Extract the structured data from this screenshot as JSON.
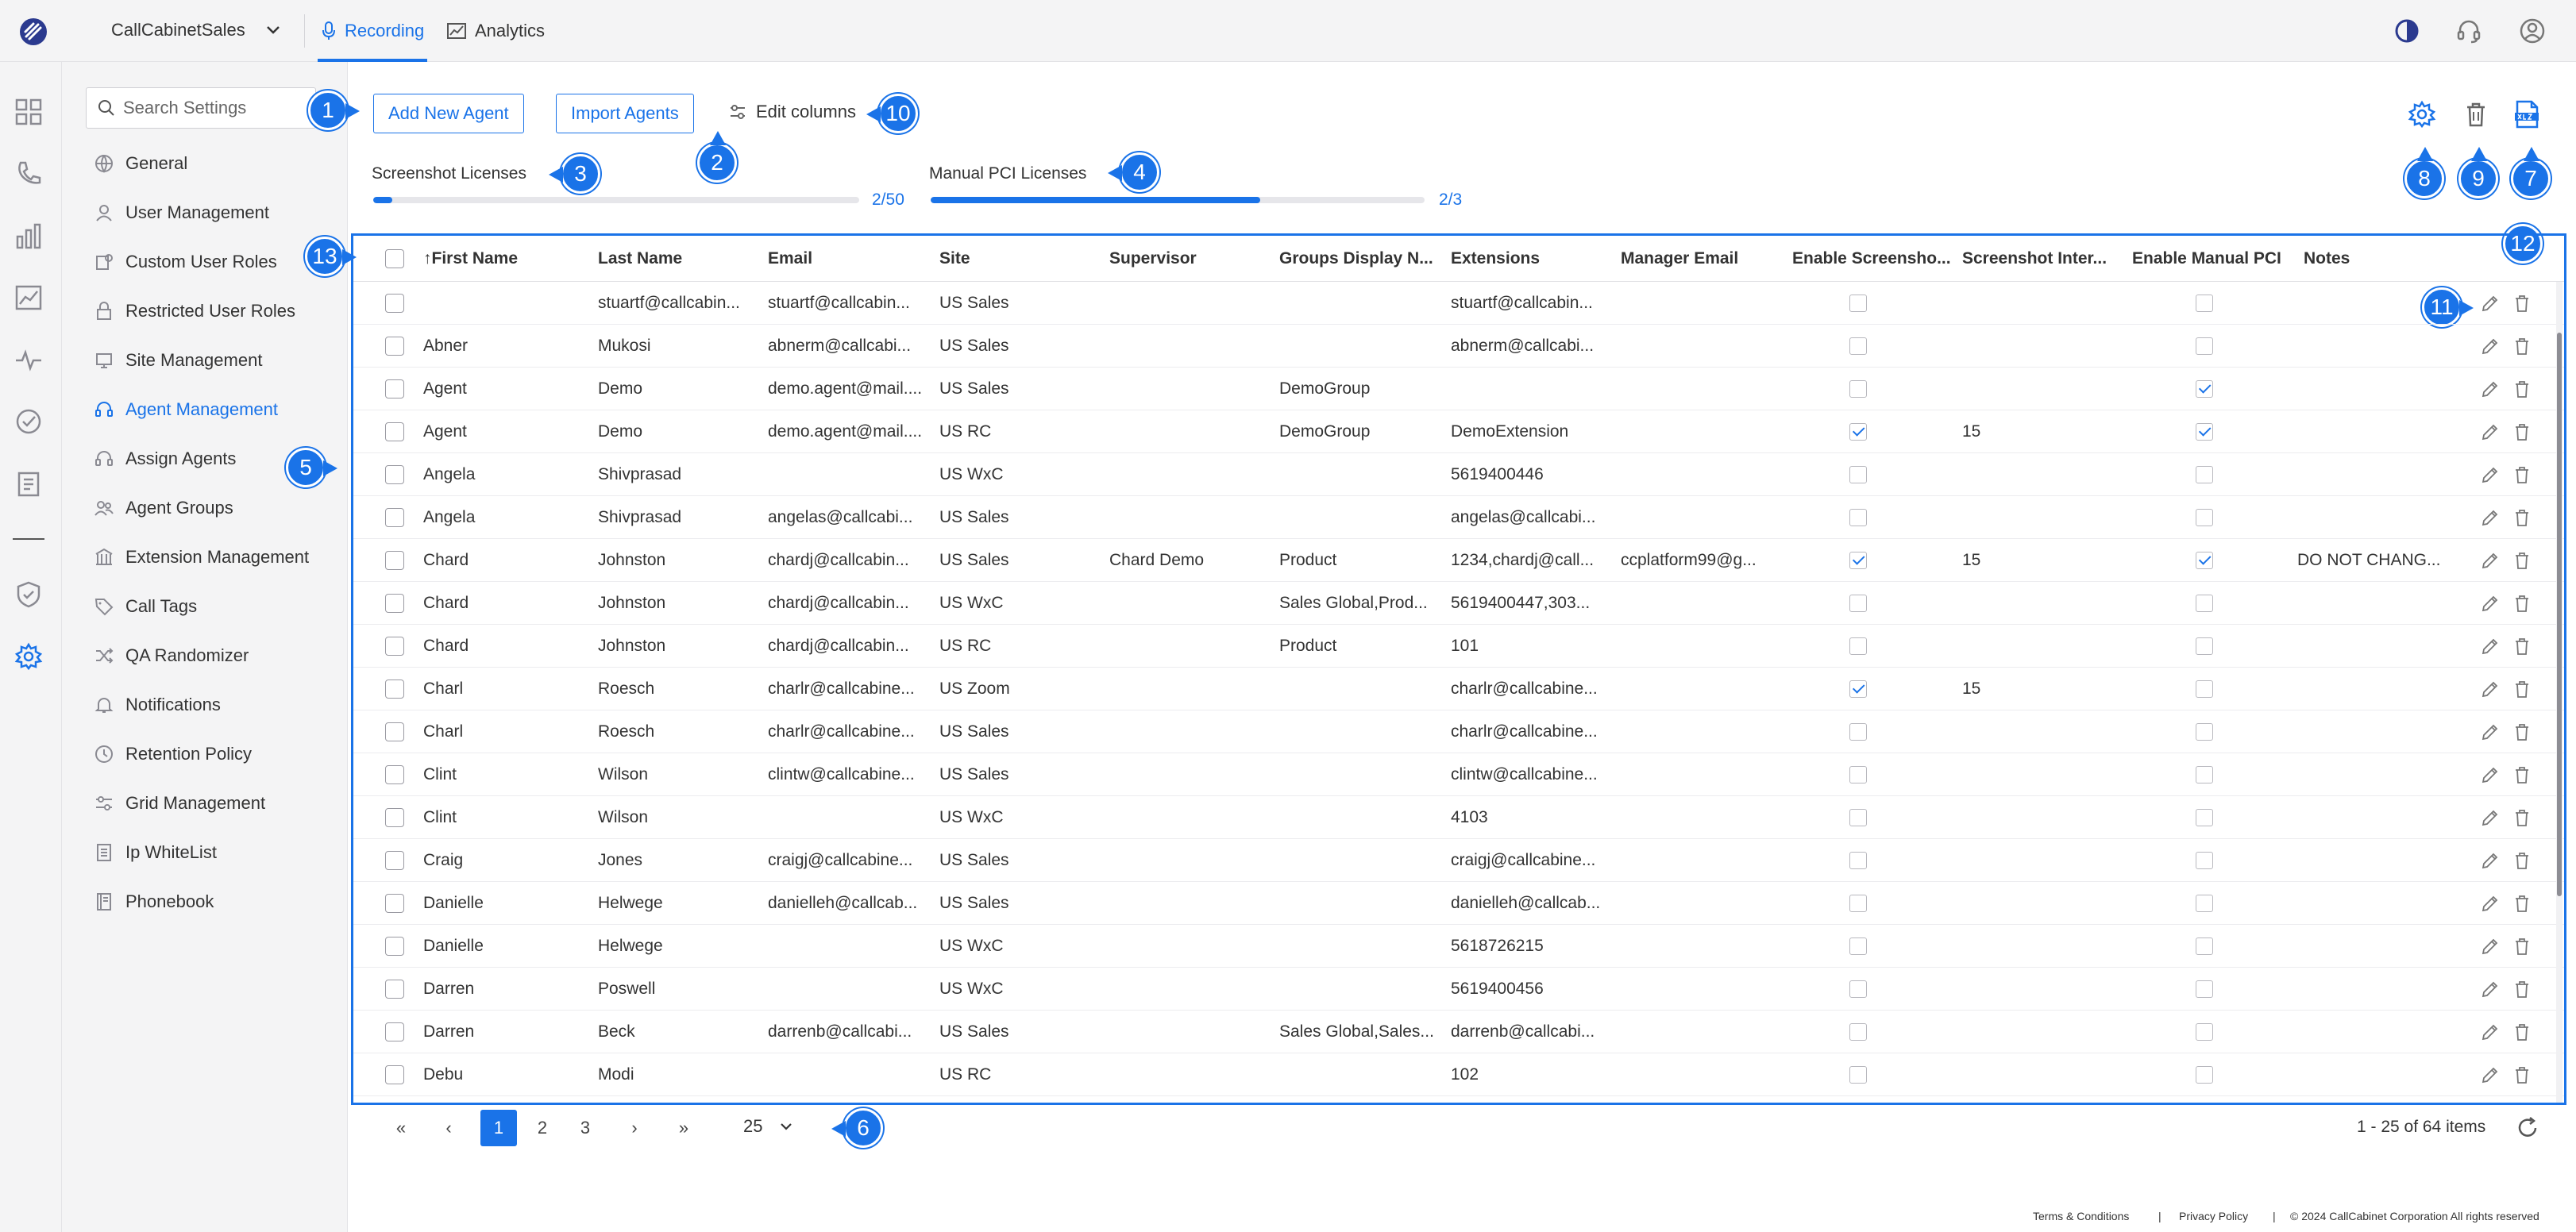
{
  "app": {
    "name": "CallCabinetSales",
    "tabs": [
      {
        "label": "Recording",
        "icon": "mic-icon",
        "active": true
      },
      {
        "label": "Analytics",
        "icon": "chart-icon",
        "active": false
      }
    ],
    "accent": "#1a73e8"
  },
  "settings": {
    "search_placeholder": "Search Settings",
    "items": [
      {
        "label": "General",
        "icon": "globe-icon"
      },
      {
        "label": "User Management",
        "icon": "user-icon"
      },
      {
        "label": "Custom User Roles",
        "icon": "roles-icon"
      },
      {
        "label": "Restricted User Roles",
        "icon": "lock-icon"
      },
      {
        "label": "Site Management",
        "icon": "site-icon"
      },
      {
        "label": "Agent Management",
        "icon": "headset-icon",
        "active": true
      },
      {
        "label": "Assign Agents",
        "icon": "headset-icon"
      },
      {
        "label": "Agent Groups",
        "icon": "group-icon"
      },
      {
        "label": "Extension Management",
        "icon": "building-icon"
      },
      {
        "label": "Call Tags",
        "icon": "tag-icon"
      },
      {
        "label": "QA Randomizer",
        "icon": "shuffle-icon"
      },
      {
        "label": "Notifications",
        "icon": "bell-icon"
      },
      {
        "label": "Retention Policy",
        "icon": "clock-icon"
      },
      {
        "label": "Grid Management",
        "icon": "sliders-icon"
      },
      {
        "label": "Ip WhiteList",
        "icon": "list-icon"
      },
      {
        "label": "Phonebook",
        "icon": "book-icon"
      }
    ]
  },
  "toolbar": {
    "add_agent": "Add New Agent",
    "import_agents": "Import Agents",
    "edit_columns": "Edit columns"
  },
  "licenses": {
    "screenshot": {
      "label": "Screenshot Licenses",
      "count": "2/50",
      "fraction": 0.04
    },
    "manual_pci": {
      "label": "Manual PCI Licenses",
      "count": "2/3",
      "fraction": 0.667
    }
  },
  "badges": [
    "1",
    "2",
    "3",
    "4",
    "5",
    "6",
    "7",
    "8",
    "9",
    "10",
    "11",
    "12",
    "13"
  ],
  "grid": {
    "columns": [
      "First Name",
      "Last Name",
      "Email",
      "Site",
      "Supervisor",
      "Groups Display N...",
      "Extensions",
      "Manager Email",
      "Enable Screensho...",
      "Screenshot Inter...",
      "Enable Manual PCI",
      "Notes"
    ],
    "sort_indicator": "↑",
    "rows": [
      {
        "first": "",
        "last": "stuartf@callcabin...",
        "email": "stuartf@callcabin...",
        "site": "US Sales",
        "supervisor": "",
        "groups": "",
        "ext": "stuartf@callcabin...",
        "manager": "",
        "ss": false,
        "interval": "",
        "pci": false,
        "notes": ""
      },
      {
        "first": "Abner",
        "last": "Mukosi",
        "email": "abnerm@callcabi...",
        "site": "US Sales",
        "supervisor": "",
        "groups": "",
        "ext": "abnerm@callcabi...",
        "manager": "",
        "ss": false,
        "interval": "",
        "pci": false,
        "notes": ""
      },
      {
        "first": "Agent",
        "last": "Demo",
        "email": "demo.agent@mail....",
        "site": "US Sales",
        "supervisor": "",
        "groups": "DemoGroup",
        "ext": "",
        "manager": "",
        "ss": false,
        "interval": "",
        "pci": true,
        "notes": ""
      },
      {
        "first": "Agent",
        "last": "Demo",
        "email": "demo.agent@mail....",
        "site": "US RC",
        "supervisor": "",
        "groups": "DemoGroup",
        "ext": "DemoExtension",
        "manager": "",
        "ss": true,
        "interval": "15",
        "pci": true,
        "notes": ""
      },
      {
        "first": "Angela",
        "last": "Shivprasad",
        "email": "",
        "site": "US WxC",
        "supervisor": "",
        "groups": "",
        "ext": "5619400446",
        "manager": "",
        "ss": false,
        "interval": "",
        "pci": false,
        "notes": ""
      },
      {
        "first": "Angela",
        "last": "Shivprasad",
        "email": "angelas@callcabi...",
        "site": "US Sales",
        "supervisor": "",
        "groups": "",
        "ext": "angelas@callcabi...",
        "manager": "",
        "ss": false,
        "interval": "",
        "pci": false,
        "notes": ""
      },
      {
        "first": "Chard",
        "last": "Johnston",
        "email": "chardj@callcabin...",
        "site": "US Sales",
        "supervisor": "Chard Demo",
        "groups": "Product",
        "ext": "1234,chardj@call...",
        "manager": "ccplatform99@g...",
        "ss": true,
        "interval": "15",
        "pci": true,
        "notes": "DO NOT CHANG..."
      },
      {
        "first": "Chard",
        "last": "Johnston",
        "email": "chardj@callcabin...",
        "site": "US WxC",
        "supervisor": "",
        "groups": "Sales Global,Prod...",
        "ext": "5619400447,303...",
        "manager": "",
        "ss": false,
        "interval": "",
        "pci": false,
        "notes": ""
      },
      {
        "first": "Chard",
        "last": "Johnston",
        "email": "chardj@callcabin...",
        "site": "US RC",
        "supervisor": "",
        "groups": "Product",
        "ext": "101",
        "manager": "",
        "ss": false,
        "interval": "",
        "pci": false,
        "notes": ""
      },
      {
        "first": "Charl",
        "last": "Roesch",
        "email": "charlr@callcabine...",
        "site": "US Zoom",
        "supervisor": "",
        "groups": "",
        "ext": "charlr@callcabine...",
        "manager": "",
        "ss": true,
        "interval": "15",
        "pci": false,
        "notes": ""
      },
      {
        "first": "Charl",
        "last": "Roesch",
        "email": "charlr@callcabine...",
        "site": "US Sales",
        "supervisor": "",
        "groups": "",
        "ext": "charlr@callcabine...",
        "manager": "",
        "ss": false,
        "interval": "",
        "pci": false,
        "notes": ""
      },
      {
        "first": "Clint",
        "last": "Wilson",
        "email": "clintw@callcabine...",
        "site": "US Sales",
        "supervisor": "",
        "groups": "",
        "ext": "clintw@callcabine...",
        "manager": "",
        "ss": false,
        "interval": "",
        "pci": false,
        "notes": ""
      },
      {
        "first": "Clint",
        "last": "Wilson",
        "email": "",
        "site": "US WxC",
        "supervisor": "",
        "groups": "",
        "ext": "4103",
        "manager": "",
        "ss": false,
        "interval": "",
        "pci": false,
        "notes": ""
      },
      {
        "first": "Craig",
        "last": "Jones",
        "email": "craigj@callcabine...",
        "site": "US Sales",
        "supervisor": "",
        "groups": "",
        "ext": "craigj@callcabine...",
        "manager": "",
        "ss": false,
        "interval": "",
        "pci": false,
        "notes": ""
      },
      {
        "first": "Danielle",
        "last": "Helwege",
        "email": "danielleh@callcab...",
        "site": "US Sales",
        "supervisor": "",
        "groups": "",
        "ext": "danielleh@callcab...",
        "manager": "",
        "ss": false,
        "interval": "",
        "pci": false,
        "notes": ""
      },
      {
        "first": "Danielle",
        "last": "Helwege",
        "email": "",
        "site": "US WxC",
        "supervisor": "",
        "groups": "",
        "ext": "5618726215",
        "manager": "",
        "ss": false,
        "interval": "",
        "pci": false,
        "notes": ""
      },
      {
        "first": "Darren",
        "last": "Poswell",
        "email": "",
        "site": "US WxC",
        "supervisor": "",
        "groups": "",
        "ext": "5619400456",
        "manager": "",
        "ss": false,
        "interval": "",
        "pci": false,
        "notes": ""
      },
      {
        "first": "Darren",
        "last": "Beck",
        "email": "darrenb@callcabi...",
        "site": "US Sales",
        "supervisor": "",
        "groups": "Sales Global,Sales...",
        "ext": "darrenb@callcabi...",
        "manager": "",
        "ss": false,
        "interval": "",
        "pci": false,
        "notes": ""
      },
      {
        "first": "Debu",
        "last": "Modi",
        "email": "",
        "site": "US RC",
        "supervisor": "",
        "groups": "",
        "ext": "102",
        "manager": "",
        "ss": false,
        "interval": "",
        "pci": false,
        "notes": ""
      }
    ]
  },
  "pager": {
    "first": "«",
    "prev": "‹",
    "pages": [
      "1",
      "2",
      "3"
    ],
    "current": "1",
    "next": "›",
    "last": "»",
    "page_size": "25",
    "items_info": "1 - 25 of 64 items"
  },
  "footer": {
    "terms": "Terms & Conditions",
    "privacy": "Privacy Policy",
    "copyright": "© 2024 CallCabinet Corporation All rights reserved",
    "sep": "|"
  }
}
